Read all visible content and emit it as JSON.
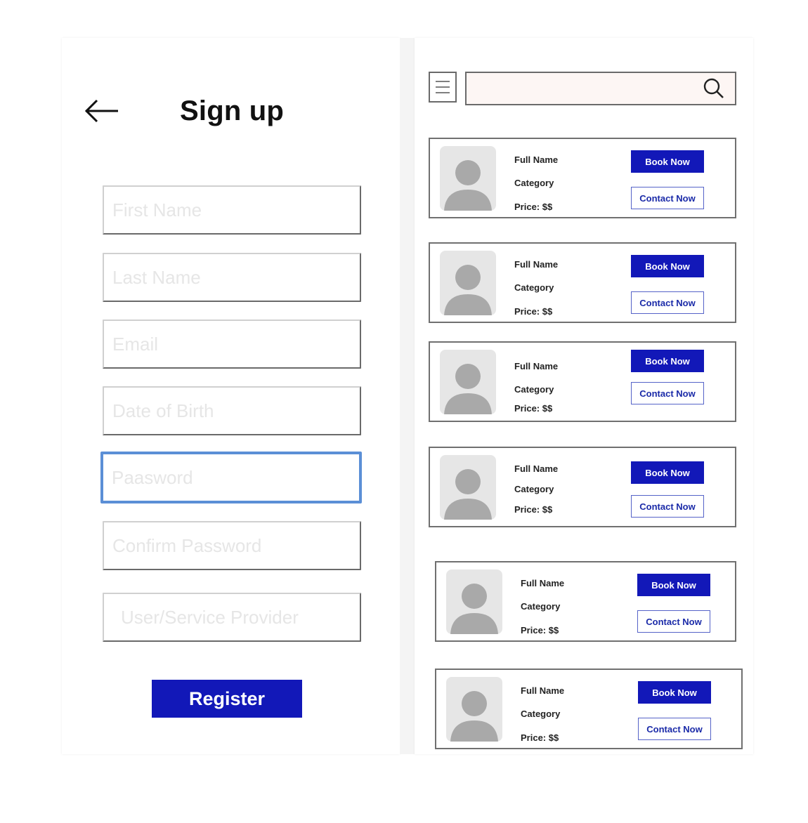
{
  "signup": {
    "title": "Sign up",
    "fields": {
      "first_name": "First Name",
      "last_name": "Last Name",
      "email": "Email",
      "dob": "Date of Birth",
      "password": "Paasword",
      "confirm_password": "Confirm Password",
      "user_type": "User/Service Provider"
    },
    "register_label": "Register",
    "focused_field": "password"
  },
  "listing": {
    "search_placeholder": "",
    "cards": [
      {
        "name": "Full Name",
        "category": "Category",
        "price": "Price: $$",
        "book_label": "Book Now",
        "contact_label": "Contact Now"
      },
      {
        "name": "Full Name",
        "category": "Category",
        "price": "Price: $$",
        "book_label": "Book Now",
        "contact_label": "Contact Now"
      },
      {
        "name": "Full Name",
        "category": "Category",
        "price": "Price: $$",
        "book_label": "Book Now",
        "contact_label": "Contact Now"
      },
      {
        "name": "Full Name",
        "category": "Category",
        "price": "Price: $$",
        "book_label": "Book Now",
        "contact_label": "Contact Now"
      },
      {
        "name": "Full Name",
        "category": "Category",
        "price": "Price: $$",
        "book_label": "Book Now",
        "contact_label": "Contact Now"
      },
      {
        "name": "Full Name",
        "category": "Category",
        "price": "Price: $$",
        "book_label": "Book Now",
        "contact_label": "Contact Now"
      }
    ]
  },
  "colors": {
    "primary": "#1218b8",
    "focus_border": "#5b8fd6",
    "avatar_bg": "#e6e6e6",
    "avatar_fg": "#a9a9a9"
  }
}
